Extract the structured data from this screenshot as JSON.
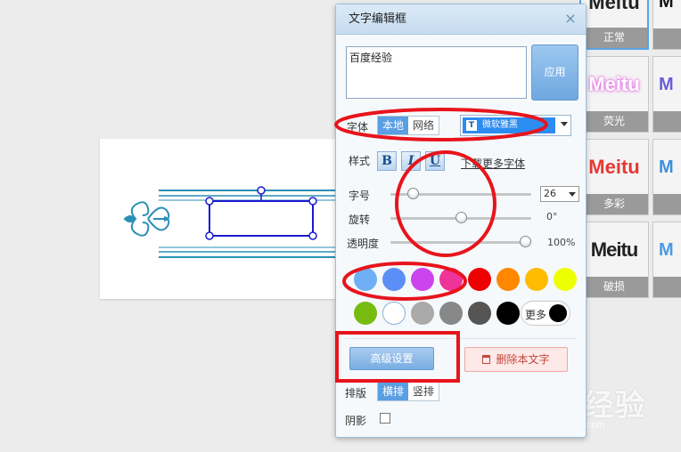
{
  "dialog": {
    "title": "文字编辑框",
    "text_value": "百度经验",
    "apply_label": "应用",
    "font_label": "字体",
    "font_source_tabs": [
      "本地",
      "网络"
    ],
    "font_selected": "微软雅黑",
    "style_label": "样式",
    "bold_label": "B",
    "italic_label": "I",
    "underline_label": "U",
    "download_fonts_label": "下载更多字体",
    "size_label": "字号",
    "size_value": "26",
    "rotate_label": "旋转",
    "rotate_value": "0°",
    "opacity_label": "透明度",
    "opacity_value": "100%",
    "more_colors_label": "更多",
    "advanced_label": "高级设置",
    "delete_label": "删除本文字",
    "layout_label": "排版",
    "layout_tabs": [
      "横排",
      "竖排"
    ],
    "shadow_label": "阴影"
  },
  "sliders": {
    "size_fraction": 0.13,
    "rotate_fraction": 0.5,
    "opacity_fraction": 1.0
  },
  "colors": {
    "row1": [
      "#6fb0f5",
      "#5b8ff5",
      "#cc44ee",
      "#ee3399",
      "#ee0000",
      "#ff8800",
      "#ffbb00",
      "#eeff00"
    ],
    "row2": [
      "#77bb11",
      "#ffffff",
      "#aaaaaa",
      "#888888",
      "#555555",
      "#000000"
    ],
    "more_dot": "#000000"
  },
  "style_tiles": [
    {
      "text": "Meitu",
      "label": "正常"
    },
    {
      "text": "Meitu",
      "label": "荧光"
    },
    {
      "text": "Meitu",
      "label": "多彩"
    },
    {
      "text": "Meitu",
      "label": "破损"
    }
  ],
  "watermark": {
    "text": "Bai 经验",
    "url": "jingyan.baidu.com"
  }
}
